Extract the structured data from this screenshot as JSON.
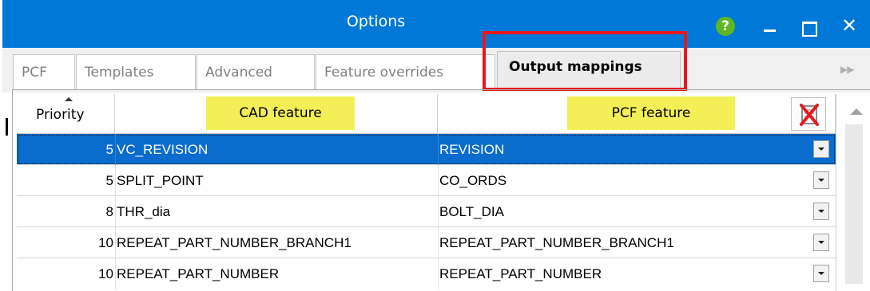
{
  "window": {
    "title": "Options"
  },
  "tabs": [
    {
      "label": "PCF"
    },
    {
      "label": "Templates"
    },
    {
      "label": "Advanced"
    },
    {
      "label": "Feature overrides"
    },
    {
      "label": "Output mappings",
      "active": true
    }
  ],
  "grid": {
    "headers": {
      "priority": "Priority",
      "cad": "CAD feature",
      "pcf": "PCF feature"
    },
    "rows": [
      {
        "priority": "5",
        "cad": "VC_REVISION",
        "pcf": "REVISION",
        "selected": true
      },
      {
        "priority": "5",
        "cad": "SPLIT_POINT",
        "pcf": "CO_ORDS"
      },
      {
        "priority": "8",
        "cad": "THR_dia",
        "pcf": "BOLT_DIA"
      },
      {
        "priority": "10",
        "cad": "REPEAT_PART_NUMBER_BRANCH1",
        "pcf": "REPEAT_PART_NUMBER_BRANCH1"
      },
      {
        "priority": "10",
        "cad": "REPEAT_PART_NUMBER",
        "pcf": "REPEAT_PART_NUMBER"
      }
    ]
  },
  "icons": {
    "help": "help-icon",
    "minimize": "minimize-icon",
    "maximize": "maximize-icon",
    "close": "close-icon",
    "delete_column": "delete-column-icon",
    "dropdown": "chevron-down-icon"
  },
  "colors": {
    "titlebar": "#0078d7",
    "selection": "#0a6ccd",
    "highlight_label": "#f4ef56",
    "annotation_box": "#e8171e"
  }
}
